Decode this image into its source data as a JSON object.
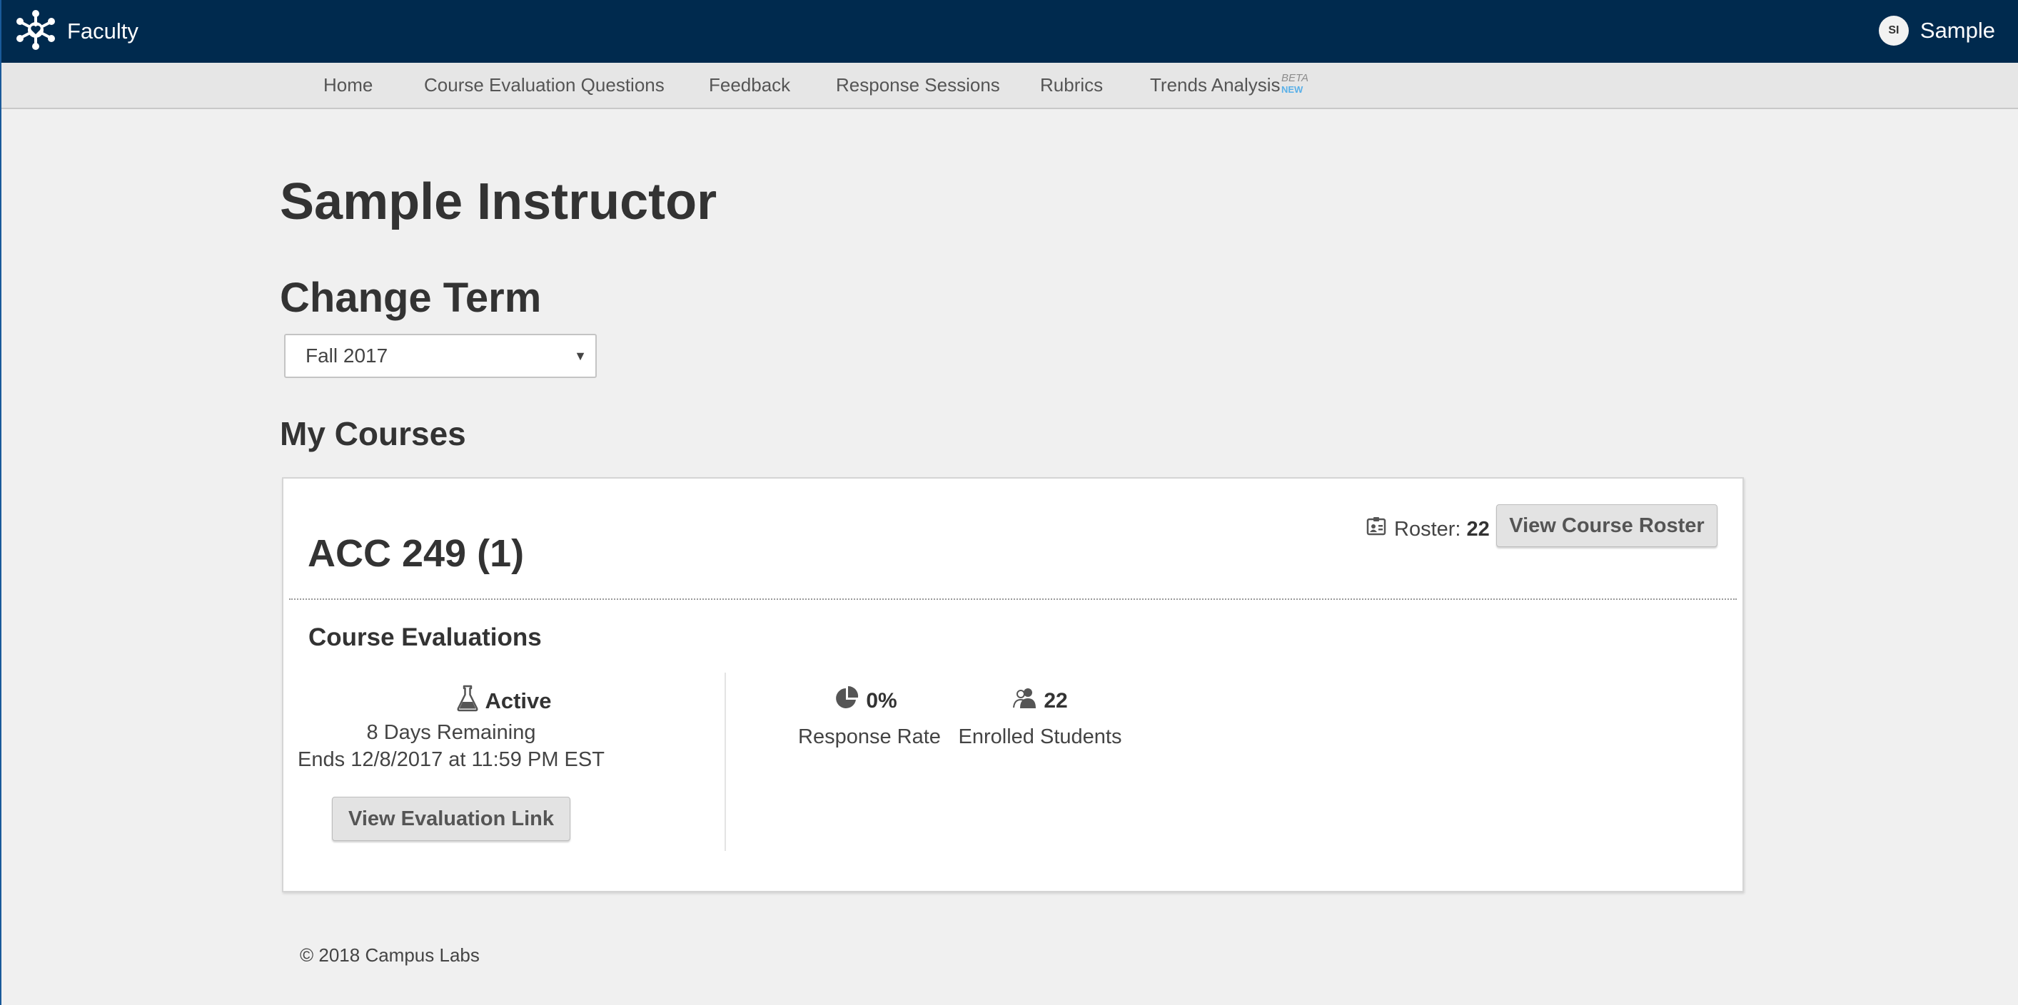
{
  "header": {
    "app_name": "Faculty",
    "user_initials": "SI",
    "user_name": "Sample",
    "bg_color": "#002a4e"
  },
  "nav": {
    "items": [
      {
        "label": "Home"
      },
      {
        "label": "Course Evaluation Questions"
      },
      {
        "label": "Feedback"
      },
      {
        "label": "Response Sessions"
      },
      {
        "label": "Rubrics"
      },
      {
        "label": "Trends Analysis",
        "badge_top": "BETA",
        "badge_bottom": "NEW"
      }
    ]
  },
  "page": {
    "title": "Sample Instructor",
    "change_term_heading": "Change Term",
    "term_selected": "Fall 2017",
    "my_courses_heading": "My Courses"
  },
  "course": {
    "title": "ACC 249 (1)",
    "roster_label": "Roster:",
    "roster_count": "22",
    "view_roster_button": "View Course Roster",
    "evaluations_heading": "Course Evaluations",
    "status": "Active",
    "days_remaining": "8 Days Remaining",
    "ends": "Ends 12/8/2017 at 11:59 PM EST",
    "view_link_button": "View Evaluation Link",
    "response_rate_value": "0%",
    "response_rate_label": "Response Rate",
    "enrolled_value": "22",
    "enrolled_label": "Enrolled Students"
  },
  "footer": {
    "copyright": "© 2018 Campus Labs"
  },
  "icons": {
    "brand": "network-heart-icon",
    "status": "flask-icon",
    "response_rate": "pie-chart-icon",
    "enrolled": "users-icon",
    "roster": "id-card-icon"
  }
}
